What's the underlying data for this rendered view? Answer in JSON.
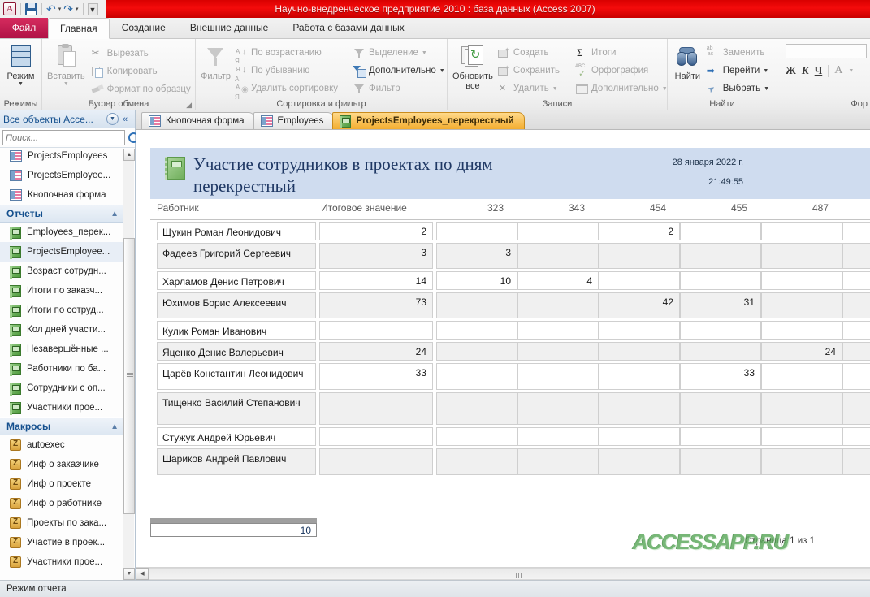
{
  "window": {
    "title": "Научно-внедренческое предприятие 2010 : база данных (Access 2007)",
    "accent_red": "#e10600",
    "file_tab": "Файл"
  },
  "quick_access": {
    "app_letter": "A",
    "save_tip": "Сохранить",
    "undo_tip": "Отменить",
    "redo_tip": "Вернуть",
    "customize_tip": "Настройка панели быстрого доступа"
  },
  "ribbon": {
    "tabs": [
      {
        "label": "Главная",
        "active": true
      },
      {
        "label": "Создание",
        "active": false
      },
      {
        "label": "Внешние данные",
        "active": false
      },
      {
        "label": "Работа с базами данных",
        "active": false
      }
    ],
    "groups": [
      {
        "name": "Режимы",
        "big": {
          "label": "Режим",
          "icon": "view-grid-icon",
          "has_dropdown": true
        }
      },
      {
        "name": "Буфер обмена",
        "big": {
          "label": "Вставить",
          "icon": "paste-icon",
          "has_dropdown": true
        },
        "items": [
          {
            "label": "Вырезать",
            "icon": "scissors-icon"
          },
          {
            "label": "Копировать",
            "icon": "copy-icon"
          },
          {
            "label": "Формат по образцу",
            "icon": "format-painter-icon"
          }
        ]
      },
      {
        "name": "Сортировка и фильтр",
        "big": {
          "label": "Фильтр",
          "icon": "funnel-icon",
          "has_dropdown": false
        },
        "items": [
          {
            "label": "По возрастанию",
            "icon": "sort-asc-icon"
          },
          {
            "label": "По убыванию",
            "icon": "sort-desc-icon"
          },
          {
            "label": "Удалить сортировку",
            "icon": "clear-sort-icon"
          },
          {
            "label": "Выделение",
            "icon": "selection-icon",
            "has_dropdown": true
          },
          {
            "label": "Дополнительно",
            "icon": "advanced-filter-icon",
            "has_dropdown": true
          },
          {
            "label": "Фильтр",
            "icon": "toggle-filter-icon"
          }
        ]
      },
      {
        "name": "Записи",
        "big": {
          "label": "Обновить все",
          "icon": "refresh-all-icon",
          "has_dropdown": true
        },
        "items": [
          {
            "label": "Создать",
            "icon": "new-record-icon"
          },
          {
            "label": "Сохранить",
            "icon": "save-record-icon"
          },
          {
            "label": "Удалить",
            "icon": "delete-record-icon",
            "has_dropdown": true
          },
          {
            "label": "Итоги",
            "icon": "totals-sigma-icon"
          },
          {
            "label": "Орфография",
            "icon": "spelling-icon"
          },
          {
            "label": "Дополнительно",
            "icon": "more-records-icon",
            "has_dropdown": true
          }
        ]
      },
      {
        "name": "Найти",
        "big": {
          "label": "Найти",
          "icon": "binoculars-icon",
          "has_dropdown": false
        },
        "items": [
          {
            "label": "Заменить",
            "icon": "replace-icon"
          },
          {
            "label": "Перейти",
            "icon": "go-to-icon",
            "has_dropdown": true
          },
          {
            "label": "Выбрать",
            "icon": "select-icon",
            "has_dropdown": true
          }
        ]
      },
      {
        "name": "Фор",
        "format": {
          "font_value": "",
          "bold": "Ж",
          "italic": "К",
          "underline": "Ч",
          "font_color": "A"
        }
      }
    ]
  },
  "nav_pane": {
    "header": "Все объекты Acce...",
    "search_placeholder": "Поиск...",
    "collapse_tip": "Свернуть область переходов",
    "items": [
      {
        "label": "ProjectsEmployees",
        "icon": "form-icon",
        "type": "form",
        "selected": false
      },
      {
        "label": "ProjectsEmployee...",
        "icon": "form-icon",
        "type": "form",
        "selected": false
      },
      {
        "label": "Кнопочная форма",
        "icon": "form-icon",
        "type": "form",
        "selected": false
      }
    ],
    "groups": [
      {
        "label": "Отчеты",
        "items": [
          {
            "label": "Employees_перек...",
            "icon": "report-icon",
            "selected": false
          },
          {
            "label": "ProjectsEmployee...",
            "icon": "report-icon",
            "selected": true
          },
          {
            "label": "Возраст сотрудн...",
            "icon": "report-icon",
            "selected": false
          },
          {
            "label": "Итоги по заказч...",
            "icon": "report-icon",
            "selected": false
          },
          {
            "label": "Итоги по сотруд...",
            "icon": "report-icon",
            "selected": false
          },
          {
            "label": "Кол дней участи...",
            "icon": "report-icon",
            "selected": false
          },
          {
            "label": "Незавершённые ...",
            "icon": "report-icon",
            "selected": false
          },
          {
            "label": "Работники по ба...",
            "icon": "report-icon",
            "selected": false
          },
          {
            "label": "Сотрудники с оп...",
            "icon": "report-icon",
            "selected": false
          },
          {
            "label": "Участники прое...",
            "icon": "report-icon",
            "selected": false
          }
        ]
      },
      {
        "label": "Макросы",
        "items": [
          {
            "label": "autoexec",
            "icon": "macro-icon",
            "selected": false
          },
          {
            "label": "Инф о заказчике",
            "icon": "macro-icon",
            "selected": false
          },
          {
            "label": "Инф о проекте",
            "icon": "macro-icon",
            "selected": false
          },
          {
            "label": "Инф о работнике",
            "icon": "macro-icon",
            "selected": false
          },
          {
            "label": "Проекты по зака...",
            "icon": "macro-icon",
            "selected": false
          },
          {
            "label": "Участие в проек...",
            "icon": "macro-icon",
            "selected": false
          },
          {
            "label": "Участники прое...",
            "icon": "macro-icon",
            "selected": false
          }
        ]
      }
    ]
  },
  "doc_tabs": [
    {
      "label": "Кнопочная форма",
      "icon": "form-icon",
      "active": false
    },
    {
      "label": "Employees",
      "icon": "form-icon",
      "active": false
    },
    {
      "label": "ProjectsEmployees_перекрестный",
      "icon": "report-icon",
      "active": true
    }
  ],
  "report": {
    "title": "Участие сотрудников в проектах по дням перекрестный",
    "icon": "report-book-icon",
    "date": "28 января 2022 г.",
    "time": "21:49:55",
    "grand_total": "10",
    "page_label": "Страница 1 из 1",
    "watermark": "ACCESSAPP.RU",
    "header_bg": "#cfdcef",
    "columns": [
      "Работник",
      "Итоговое значение",
      "323",
      "343",
      "454",
      "455",
      "487"
    ],
    "rows": [
      {
        "name": "Щукин Роман Леонидович",
        "values": [
          "2",
          "",
          "",
          "2",
          "",
          ""
        ]
      },
      {
        "name": "Фадеев Григорий Сергеевич",
        "values": [
          "3",
          "3",
          "",
          "",
          "",
          ""
        ]
      },
      {
        "name": "Харламов Денис Петрович",
        "values": [
          "14",
          "10",
          "4",
          "",
          "",
          ""
        ]
      },
      {
        "name": "Юхимов Борис Алексеевич",
        "values": [
          "73",
          "",
          "",
          "42",
          "31",
          ""
        ]
      },
      {
        "name": "Кулик Роман Иванович",
        "values": [
          "",
          "",
          "",
          "",
          "",
          ""
        ]
      },
      {
        "name": "Яценко Денис Валерьевич",
        "values": [
          "24",
          "",
          "",
          "",
          "",
          "24"
        ]
      },
      {
        "name": "Царёв Константин Леонидович",
        "values": [
          "33",
          "",
          "",
          "",
          "33",
          ""
        ]
      },
      {
        "name": "Тищенко Василий Степанович",
        "values": [
          "",
          "",
          "",
          "",
          "",
          ""
        ]
      },
      {
        "name": "Стужук Андрей Юрьевич",
        "values": [
          "",
          "",
          "",
          "",
          "",
          ""
        ]
      },
      {
        "name": "Шариков Андрей Павлович",
        "values": [
          "",
          "",
          "",
          "",
          "",
          ""
        ]
      }
    ]
  },
  "status_bar": {
    "mode": "Режим отчета"
  }
}
